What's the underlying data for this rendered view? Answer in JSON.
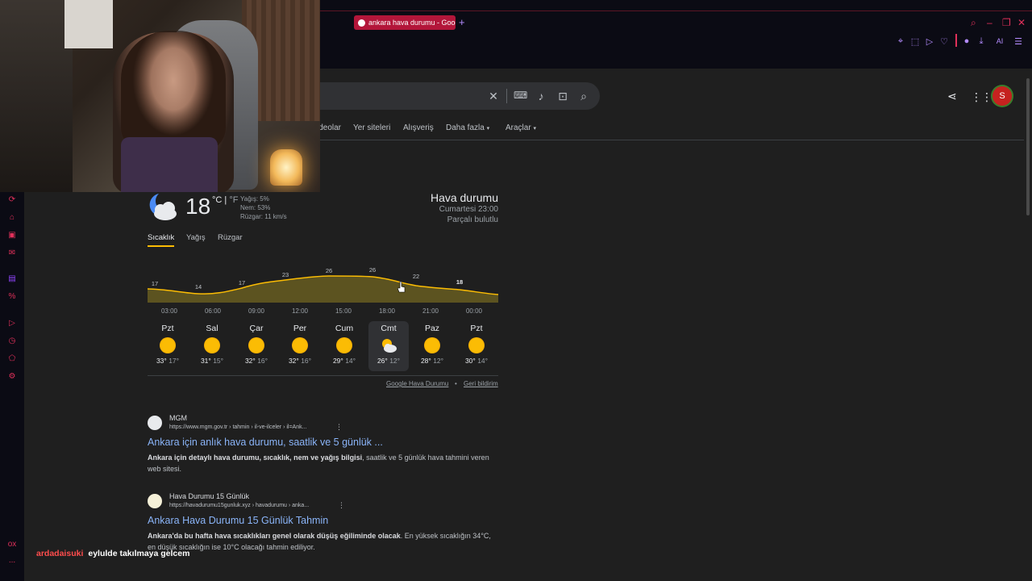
{
  "browser": {
    "tab_title": "ankara hava durumu - Goog",
    "new_tab": "+",
    "window_controls": [
      "⌕",
      "–",
      "❐",
      "✕"
    ],
    "nav_icons": [
      "pin-icon",
      "screenshot-icon",
      "send-icon",
      "heart-icon",
      "profile-icon",
      "download-icon",
      "ai-icon",
      "menu-icon"
    ],
    "ai_label": "AI"
  },
  "sidebar": {
    "icons": [
      "history-icon",
      "shop-icon",
      "messenger-icon",
      "mail-icon",
      "twitch-icon",
      "percent-icon",
      "play-icon",
      "clock-icon",
      "extension-icon",
      "settings-icon"
    ],
    "bottom": [
      "ox",
      "..."
    ]
  },
  "search": {
    "filters": [
      "Videolar",
      "Yer siteleri",
      "Alışveriş",
      "Daha fazla",
      "Araçlar"
    ],
    "avatar_letter": "S"
  },
  "weather": {
    "temperature": "18",
    "unit_c": "°C",
    "unit_f": "°F",
    "precip": "Yağış: 5%",
    "humidity": "Nem: 53%",
    "wind": "Rüzgar: 11 km/s",
    "title": "Hava durumu",
    "time": "Cumartesi 23:00",
    "condition": "Parçalı bulutlu",
    "tabs": [
      "Sıcaklık",
      "Yağış",
      "Rüzgar"
    ],
    "hourly_values": [
      "17",
      "14",
      "17",
      "23",
      "26",
      "26",
      "22",
      "18"
    ],
    "hourly_times": [
      "03:00",
      "06:00",
      "09:00",
      "12:00",
      "15:00",
      "18:00",
      "21:00",
      "00:00"
    ],
    "days": [
      {
        "name": "Pzt",
        "high": "33°",
        "low": "17°",
        "icon": "sun-icon"
      },
      {
        "name": "Sal",
        "high": "31°",
        "low": "15°",
        "icon": "sun-icon"
      },
      {
        "name": "Çar",
        "high": "32°",
        "low": "16°",
        "icon": "sun-icon"
      },
      {
        "name": "Per",
        "high": "32°",
        "low": "16°",
        "icon": "sun-icon"
      },
      {
        "name": "Cum",
        "high": "29°",
        "low": "14°",
        "icon": "sun-icon"
      },
      {
        "name": "Cmt",
        "high": "26°",
        "low": "12°",
        "icon": "partly-cloudy-icon"
      },
      {
        "name": "Paz",
        "high": "28°",
        "low": "12°",
        "icon": "sun-icon"
      },
      {
        "name": "Pzt",
        "high": "30°",
        "low": "14°",
        "icon": "sun-icon"
      }
    ],
    "footer_source": "Google Hava Durumu",
    "footer_sep": "•",
    "footer_feedback": "Geri bildirim"
  },
  "results": [
    {
      "site": "MGM",
      "url": "https://www.mgm.gov.tr › tahmin › il-ve-ilceler › il=Ank...",
      "title": "Ankara için anlık hava durumu, saatlik ve 5 günlük ...",
      "snippet_bold": "Ankara için detaylı hava durumu, sıcaklık, nem ve yağış bilgisi",
      "snippet_rest": ", saatlik ve 5 günlük hava tahmini veren web sitesi."
    },
    {
      "site": "Hava Durumu 15 Günlük",
      "url": "https://havadurumu15gunluk.xyz › havadurumu › anka...",
      "title": "Ankara Hava Durumu 15 Günlük Tahmin",
      "snippet_bold": "Ankara'da bu hafta hava sıcaklıkları genel olarak düşüş eğiliminde olacak",
      "snippet_rest": ". En yüksek sıcaklığın 34°C, en düşük sıcaklığın ise 10°C olacağı tahmin ediliyor."
    }
  ],
  "chat": {
    "user": "ardadaisuki",
    "message": "eylulde takılmaya gelcem"
  }
}
